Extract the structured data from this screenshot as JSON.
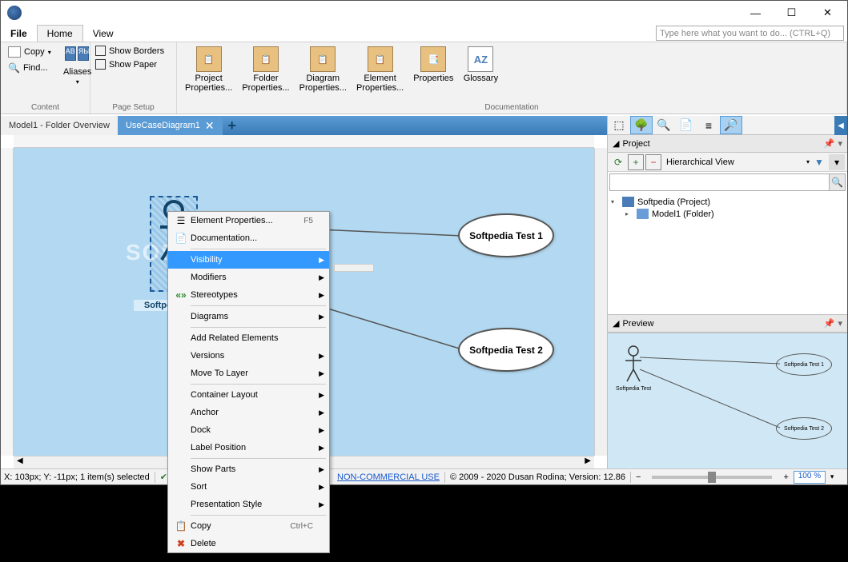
{
  "titlebar": {
    "min": "—",
    "max": "☐",
    "close": "✕"
  },
  "menubar": {
    "file": "File",
    "home": "Home",
    "view": "View",
    "search_placeholder": "Type here what you want to do...   (CTRL+Q)"
  },
  "ribbon": {
    "content": {
      "group": "Content",
      "copy": "Copy",
      "find": "Find...",
      "aliases": "Aliases"
    },
    "pagesetup": {
      "group": "Page Setup",
      "show_borders": "Show Borders",
      "show_paper": "Show Paper"
    },
    "documentation": {
      "group": "Documentation",
      "project_props": "Project\nProperties...",
      "folder_props": "Folder\nProperties...",
      "diagram_props": "Diagram\nProperties...",
      "element_props": "Element\nProperties...",
      "properties": "Properties",
      "glossary": "Glossary"
    }
  },
  "tabs": {
    "inactive": "Model1 - Folder Overview",
    "active": "UseCaseDiagram1",
    "add": "+"
  },
  "canvas": {
    "watermark": "SOFTPEDIA",
    "actor_label": "Softpe",
    "usecase1": "Softpedia Test 1",
    "usecase2": "Softpedia Test 2"
  },
  "context_menu": {
    "element_props": "Element Properties...",
    "element_props_sc": "F5",
    "documentation": "Documentation...",
    "visibility": "Visibility",
    "modifiers": "Modifiers",
    "stereotypes": "Stereotypes",
    "diagrams": "Diagrams",
    "add_related": "Add Related Elements",
    "versions": "Versions",
    "move_layer": "Move To Layer",
    "container_layout": "Container Layout",
    "anchor": "Anchor",
    "dock": "Dock",
    "label_position": "Label Position",
    "show_parts": "Show Parts",
    "sort": "Sort",
    "presentation": "Presentation Style",
    "copy": "Copy",
    "copy_sc": "Ctrl+C",
    "delete": "Delete"
  },
  "project_panel": {
    "title": "Project",
    "view_mode": "Hierarchical View",
    "root": "Softpedia (Project)",
    "child": "Model1 (Folder)"
  },
  "preview_panel": {
    "title": "Preview",
    "actor_label": "Softpedia Test",
    "uc1": "Softpedia Test 1",
    "uc2": "Softpedia Test 2"
  },
  "statusbar": {
    "coords": "X: 103px; Y: -11px; 1 item(s) selected",
    "non_commercial": "NON-COMMERCIAL USE",
    "copyright": "© 2009 - 2020 Dusan Rodina; Version: 12.86",
    "zoom": "100 %"
  }
}
